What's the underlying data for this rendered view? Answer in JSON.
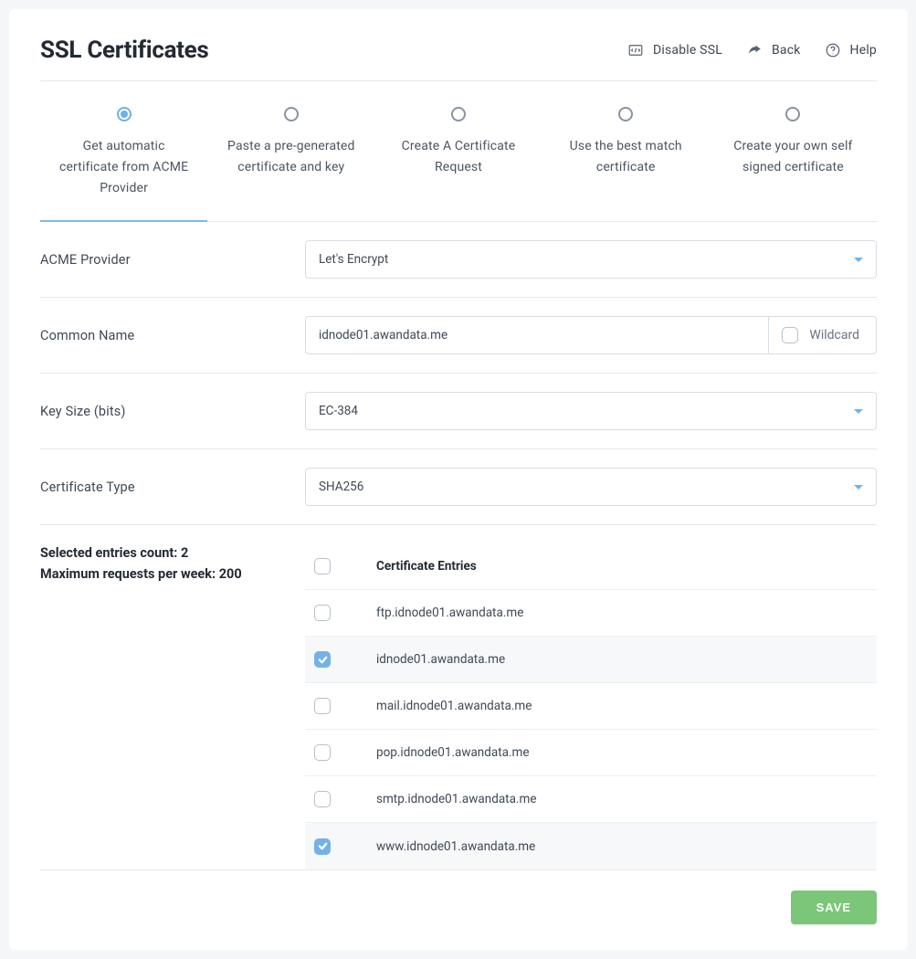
{
  "header": {
    "title": "SSL Certificates",
    "actions": {
      "disable_ssl": "Disable SSL",
      "back": "Back",
      "help": "Help"
    }
  },
  "tabs": [
    {
      "label": "Get automatic certificate from ACME Provider",
      "active": true
    },
    {
      "label": "Paste a pre-generated certificate and key",
      "active": false
    },
    {
      "label": "Create A Certificate Request",
      "active": false
    },
    {
      "label": "Use the best match certificate",
      "active": false
    },
    {
      "label": "Create your own self signed certificate",
      "active": false
    }
  ],
  "form": {
    "acme_provider": {
      "label": "ACME Provider",
      "value": "Let's Encrypt"
    },
    "common_name": {
      "label": "Common Name",
      "value": "idnode01.awandata.me",
      "wildcard_label": "Wildcard",
      "wildcard_checked": false
    },
    "key_size": {
      "label": "Key Size (bits)",
      "value": "EC-384"
    },
    "cert_type": {
      "label": "Certificate Type",
      "value": "SHA256"
    }
  },
  "entries": {
    "count_line": "Selected entries count: 2",
    "max_line": "Maximum requests per week: 200",
    "header": "Certificate Entries",
    "rows": [
      {
        "name": "ftp.idnode01.awandata.me",
        "checked": false
      },
      {
        "name": "idnode01.awandata.me",
        "checked": true
      },
      {
        "name": "mail.idnode01.awandata.me",
        "checked": false
      },
      {
        "name": "pop.idnode01.awandata.me",
        "checked": false
      },
      {
        "name": "smtp.idnode01.awandata.me",
        "checked": false
      },
      {
        "name": "www.idnode01.awandata.me",
        "checked": true
      }
    ]
  },
  "footer": {
    "save": "SAVE"
  }
}
